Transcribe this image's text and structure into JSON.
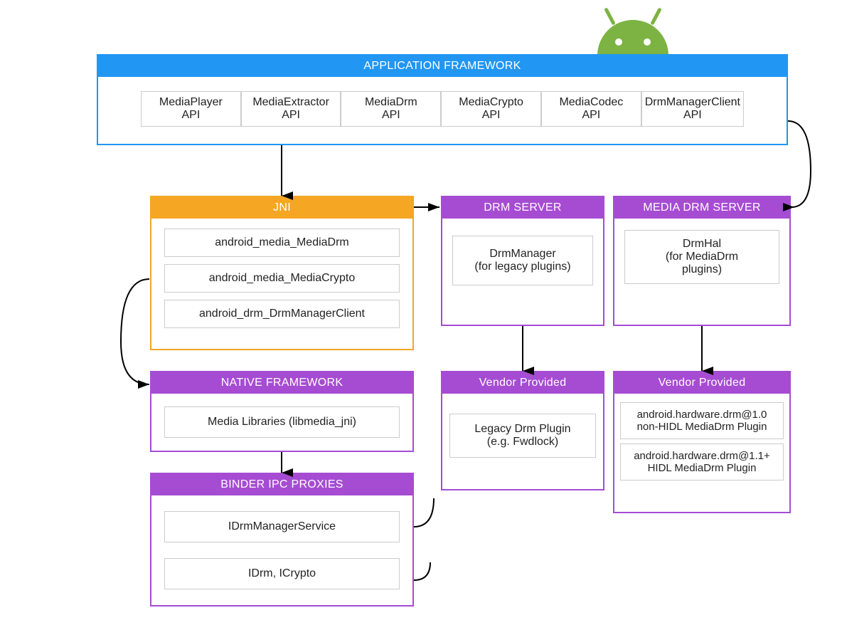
{
  "application_framework": {
    "title": "APPLICATION FRAMEWORK",
    "apis": [
      {
        "line1": "MediaPlayer",
        "line2": "API"
      },
      {
        "line1": "MediaExtractor",
        "line2": "API"
      },
      {
        "line1": "MediaDrm",
        "line2": "API"
      },
      {
        "line1": "MediaCrypto",
        "line2": "API"
      },
      {
        "line1": "MediaCodec",
        "line2": "API"
      },
      {
        "line1": "DrmManagerClient",
        "line2": "API"
      }
    ]
  },
  "jni": {
    "title": "JNI",
    "items": [
      "android_media_MediaDrm",
      "android_media_MediaCrypto",
      "android_drm_DrmManagerClient"
    ]
  },
  "drm_server": {
    "title": "DRM SERVER",
    "item_line1": "DrmManager",
    "item_line2": "(for legacy plugins)"
  },
  "media_drm_server": {
    "title": "MEDIA DRM SERVER",
    "item_line1": "DrmHal",
    "item_line2": "(for MediaDrm",
    "item_line3": "plugins)"
  },
  "native_framework": {
    "title": "NATIVE FRAMEWORK",
    "item": "Media Libraries (libmedia_jni)"
  },
  "vendor1": {
    "title": "Vendor Provided",
    "item_line1": "Legacy Drm Plugin",
    "item_line2": "(e.g. Fwdlock)"
  },
  "vendor2": {
    "title": "Vendor Provided",
    "items": [
      {
        "line1": "android.hardware.drm@1.0",
        "line2": "non-HIDL MediaDrm Plugin"
      },
      {
        "line1": "android.hardware.drm@1.1+",
        "line2": "HIDL MediaDrm Plugin"
      }
    ]
  },
  "binder": {
    "title": "BINDER IPC PROXIES",
    "items": [
      "IDrmManagerService",
      "IDrm, ICrypto"
    ]
  }
}
